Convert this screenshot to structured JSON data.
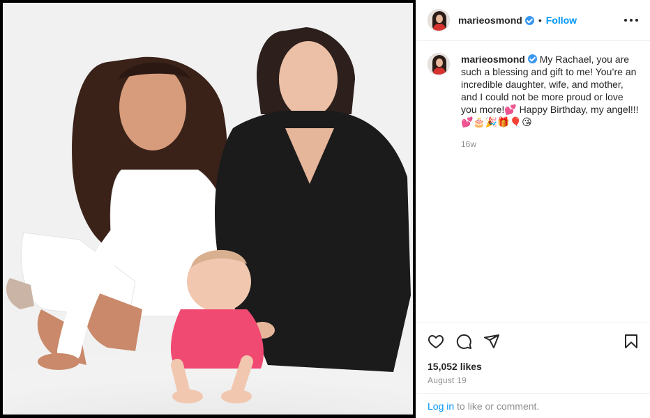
{
  "post": {
    "username": "marieosmond",
    "separator": "•",
    "follow_label": "Follow",
    "caption": "My Rachael, you are such a blessing and gift to me! You’re an incredible daughter, wife, and mother, and I could not be more proud or love you more!💕 Happy Birthday, my angel!!!💕🎂🎉🎁🎈😘",
    "time_ago": "16w",
    "likes": "15,052 likes",
    "date": "August 19",
    "login_link": "Log in",
    "login_suffix": " to like or comment."
  },
  "colors": {
    "link_blue": "#0095f6",
    "verified_blue": "#3897f0",
    "text": "#262626",
    "muted": "#8e8e8e"
  },
  "icons": {
    "verified": "verified-badge-icon",
    "more": "more-options-icon",
    "like": "heart-icon",
    "comment": "comment-icon",
    "share": "paper-plane-icon",
    "save": "bookmark-icon"
  }
}
